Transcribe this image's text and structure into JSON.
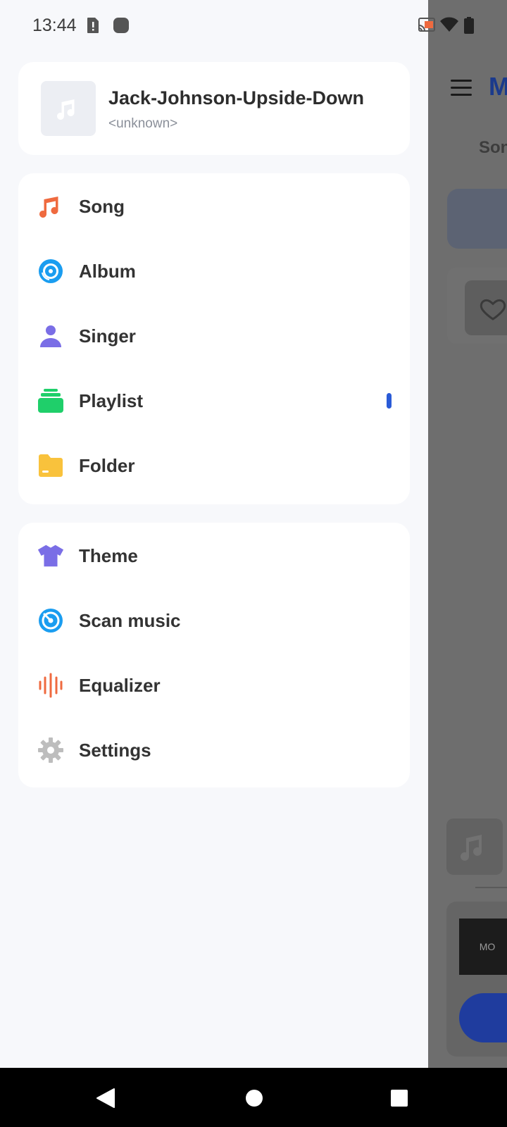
{
  "status_bar": {
    "time": "13:44"
  },
  "now_playing": {
    "title": "Jack-Johnson-Upside-Down",
    "artist": "<unknown>"
  },
  "menu_primary": [
    {
      "label": "Song",
      "icon": "music-note-icon"
    },
    {
      "label": "Album",
      "icon": "album-disc-icon"
    },
    {
      "label": "Singer",
      "icon": "person-icon"
    },
    {
      "label": "Playlist",
      "icon": "playlist-stack-icon"
    },
    {
      "label": "Folder",
      "icon": "folder-icon"
    }
  ],
  "menu_secondary": [
    {
      "label": "Theme",
      "icon": "tshirt-icon"
    },
    {
      "label": "Scan music",
      "icon": "scan-icon"
    },
    {
      "label": "Equalizer",
      "icon": "equalizer-icon"
    },
    {
      "label": "Settings",
      "icon": "gear-icon"
    }
  ],
  "background_app": {
    "title_partial": "M",
    "tab_partial": "Son",
    "mini_label": "MO"
  },
  "colors": {
    "accent": "#2a5bd7",
    "song": "#ef6a3f",
    "album": "#1a9df0",
    "singer": "#7a6ee6",
    "playlist": "#1fcf6a",
    "folder": "#f9c23c",
    "theme": "#7a6ee6",
    "scan": "#1a9df0",
    "equalizer": "#ef6a3f",
    "settings": "#bdbdbd"
  }
}
